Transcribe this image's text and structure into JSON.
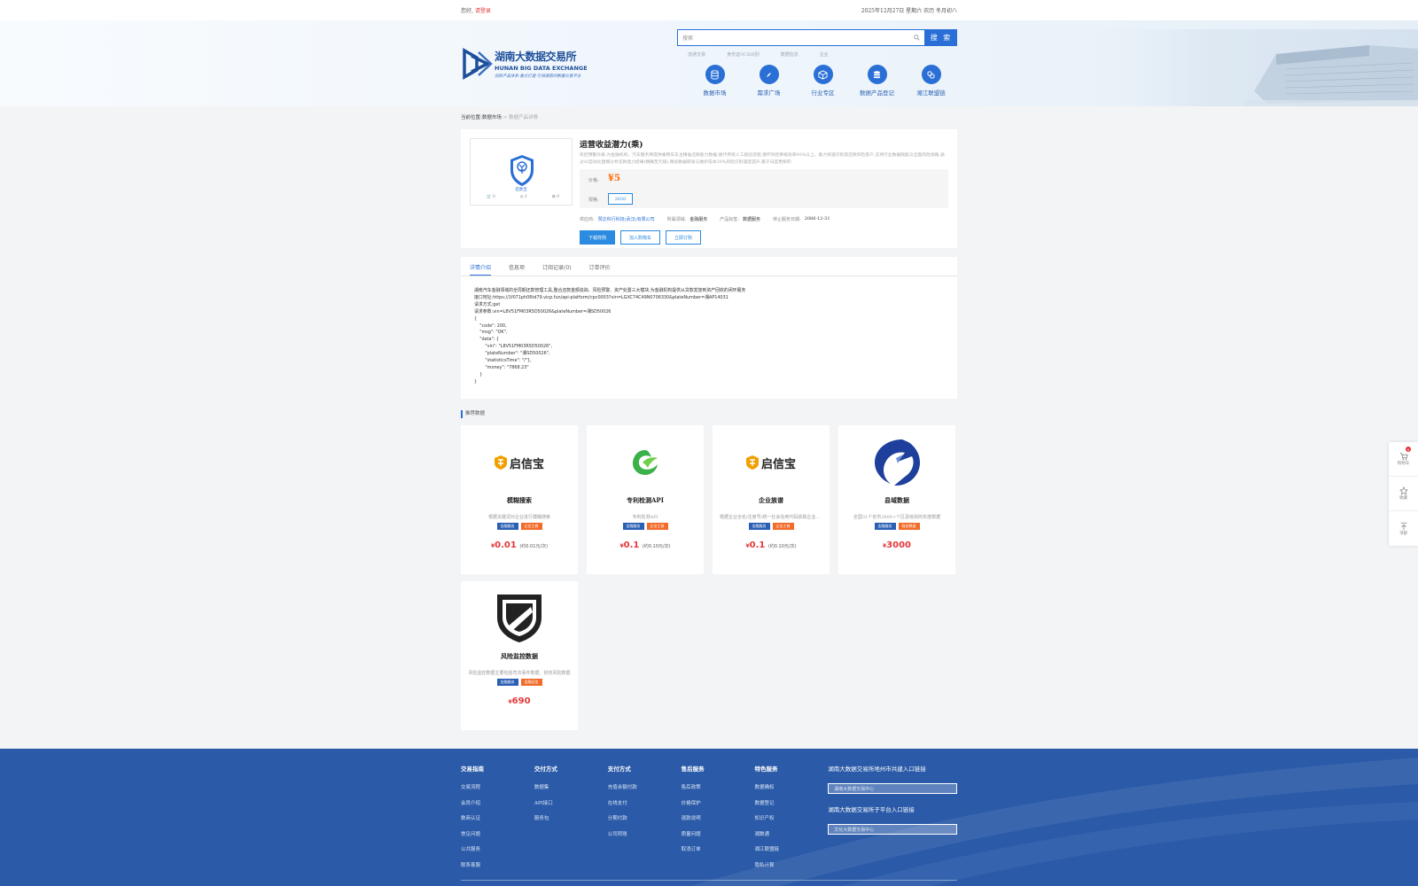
{
  "topbar": {
    "greeting": "您好,",
    "login": "请登录",
    "date": "2025年12月27日 星期六 农历 冬月初八"
  },
  "header": {
    "logo_cn": "湖南大数据交易所",
    "logo_en": "HUNAN BIG DATA EXCHANGE",
    "logo_slogan": "创新产品体系·重点打造·引领湖南的数据交易平台",
    "search_placeholder": "搜索",
    "search_button": "搜 索",
    "hot_words": [
      "流通交易",
      "身份证OCR识别",
      "数据信息",
      "企业"
    ],
    "nav": [
      {
        "label": "数据市场",
        "icon": "database-icon"
      },
      {
        "label": "需求广场",
        "icon": "compass-icon"
      },
      {
        "label": "行业专区",
        "icon": "cube-icon"
      },
      {
        "label": "数据产品登记",
        "icon": "register-icon"
      },
      {
        "label": "湘江联盟链",
        "icon": "chain-icon"
      }
    ]
  },
  "breadcrumb": {
    "prefix": "当前位置:",
    "market": "数据市场",
    "sep": ">",
    "current": "数据产品详情"
  },
  "product": {
    "title": "运营收益潜力(乘)",
    "desc": "风控预警升级:为金融机构、汽车服务商提供乘用车车主精准还款能力数据,替代传统人工核验流程,使坏风控审核效率90%以上。助力快速识别高还款风险客户,支持行业数据赋能与全面风险视角,通过AI自动化建模分析还款能力结果(精确至元级),降低数据研发与维护成本30%风险识别速度提升,基于日度更新的",
    "price_label": "价格:",
    "price": "¥5",
    "spec_label": "规格:",
    "spec": "2650",
    "supplier_label": "供应商:",
    "supplier": "赞达科行科技(武汉)有限公司",
    "area_label": "所属领域:",
    "area": "金融服务",
    "ptype_label": "产品标签:",
    "ptype": "数据服务",
    "end_label": "停止服务日期:",
    "end": "2086-12-31",
    "btn_sample": "下载样例",
    "btn_cart": "加入购物车",
    "btn_buy": "立即订购",
    "cart_count": "0",
    "view_count": "1",
    "fav_count": "0",
    "shield_label": "还款宝"
  },
  "tabs": [
    "详情介绍",
    "信息项",
    "订阅记录(0)",
    "订单评价"
  ],
  "detail_text": "湖南汽车金融领域的全周期还款管理工具,整合还款金额追踪、风险预警、资产处置三大模块,为金融机构提供从贷款发放到资产回收的闭环服务\n接口地址:https://1f071ph06td79.vicp.fun/api-platform/cpc0003?vin=LGXC74C49N0706330&plateNumber=湘AP14031\n请求方式:get\n请求参数:vin=L8V51FM03R5D50026&plateNumber=湘SD50026\n{\n    \"code\": 200,\n    \"msg\": \"OK\",\n    \"data\": {\n        \"vin\": \"L8V51FM03R5D50026\",\n        \"plateNumber\": \"湘SD50026\",\n        \"statisticsTime\": \"/\"},\n        \"money\": \"7868.23\"\n    }\n}",
  "recommend": {
    "title": "推荐数据",
    "cards": [
      {
        "name": "模糊搜索",
        "desc": "根据关键词对企业进行模糊搜索",
        "tags": [
          "金融服务",
          "企业工商"
        ],
        "price": "0.01",
        "unit": "(约0.01元/次)",
        "logo": "qixinbao-logo"
      },
      {
        "name": "专利检测API",
        "desc": "专利检测API",
        "tags": [
          "金融服务",
          "企业工商"
        ],
        "price": "0.1",
        "unit": "(约0.10元/次)",
        "logo": "leaf-logo"
      },
      {
        "name": "企业族谱",
        "desc": "根据企业全名/注册号/统一社会信用代码获取企业族谱",
        "tags": [
          "金融服务",
          "企业工商"
        ],
        "price": "0.1",
        "unit": "(约0.10元/次)",
        "logo": "qixinbao-logo"
      },
      {
        "name": "县域数据",
        "desc": "全国31个省市2800+个区县级别的年度数据",
        "tags": [
          "金融服务",
          "政务数据"
        ],
        "price": "3000",
        "unit": "",
        "logo": "county-logo"
      },
      {
        "name": "风险监控数据",
        "desc": "风险监控数据主要包括司法事件数据、财务风险数据",
        "tags": [
          "金融服务",
          "金融征信"
        ],
        "price": "690",
        "unit": "",
        "logo": "shield-logo"
      }
    ],
    "qxb_text": "启信宝",
    "currency": "¥"
  },
  "side": {
    "cart": "购物车",
    "cart_badge": "0",
    "fav": "收藏",
    "top": "顶部"
  },
  "footer": {
    "cols": [
      {
        "title": "交易指南",
        "items": [
          "交易流程",
          "会员介绍",
          "数商认证",
          "常见问题",
          "公共服务",
          "联系客服"
        ]
      },
      {
        "title": "交付方式",
        "items": [
          "数据集",
          "API接口",
          "服务包"
        ]
      },
      {
        "title": "支付方式",
        "items": [
          "充值余额付款",
          "在线支付",
          "分期付款",
          "公司转账"
        ]
      },
      {
        "title": "售后服务",
        "items": [
          "售后政策",
          "价格保护",
          "退款说明",
          "质量问题",
          "取消订单"
        ]
      },
      {
        "title": "特色服务",
        "items": [
          "数据确权",
          "数据登记",
          "知识产权",
          "湘数通",
          "湘江联盟链",
          "隐私计算"
        ]
      }
    ],
    "link1_title": "湖南大数据交易所地州市共建入口链接",
    "link1_select": "湖南大数据交易中心",
    "link2_title": "湖南大数据交易所子平台入口链接",
    "link2_select": "文化大数据交易中心"
  }
}
